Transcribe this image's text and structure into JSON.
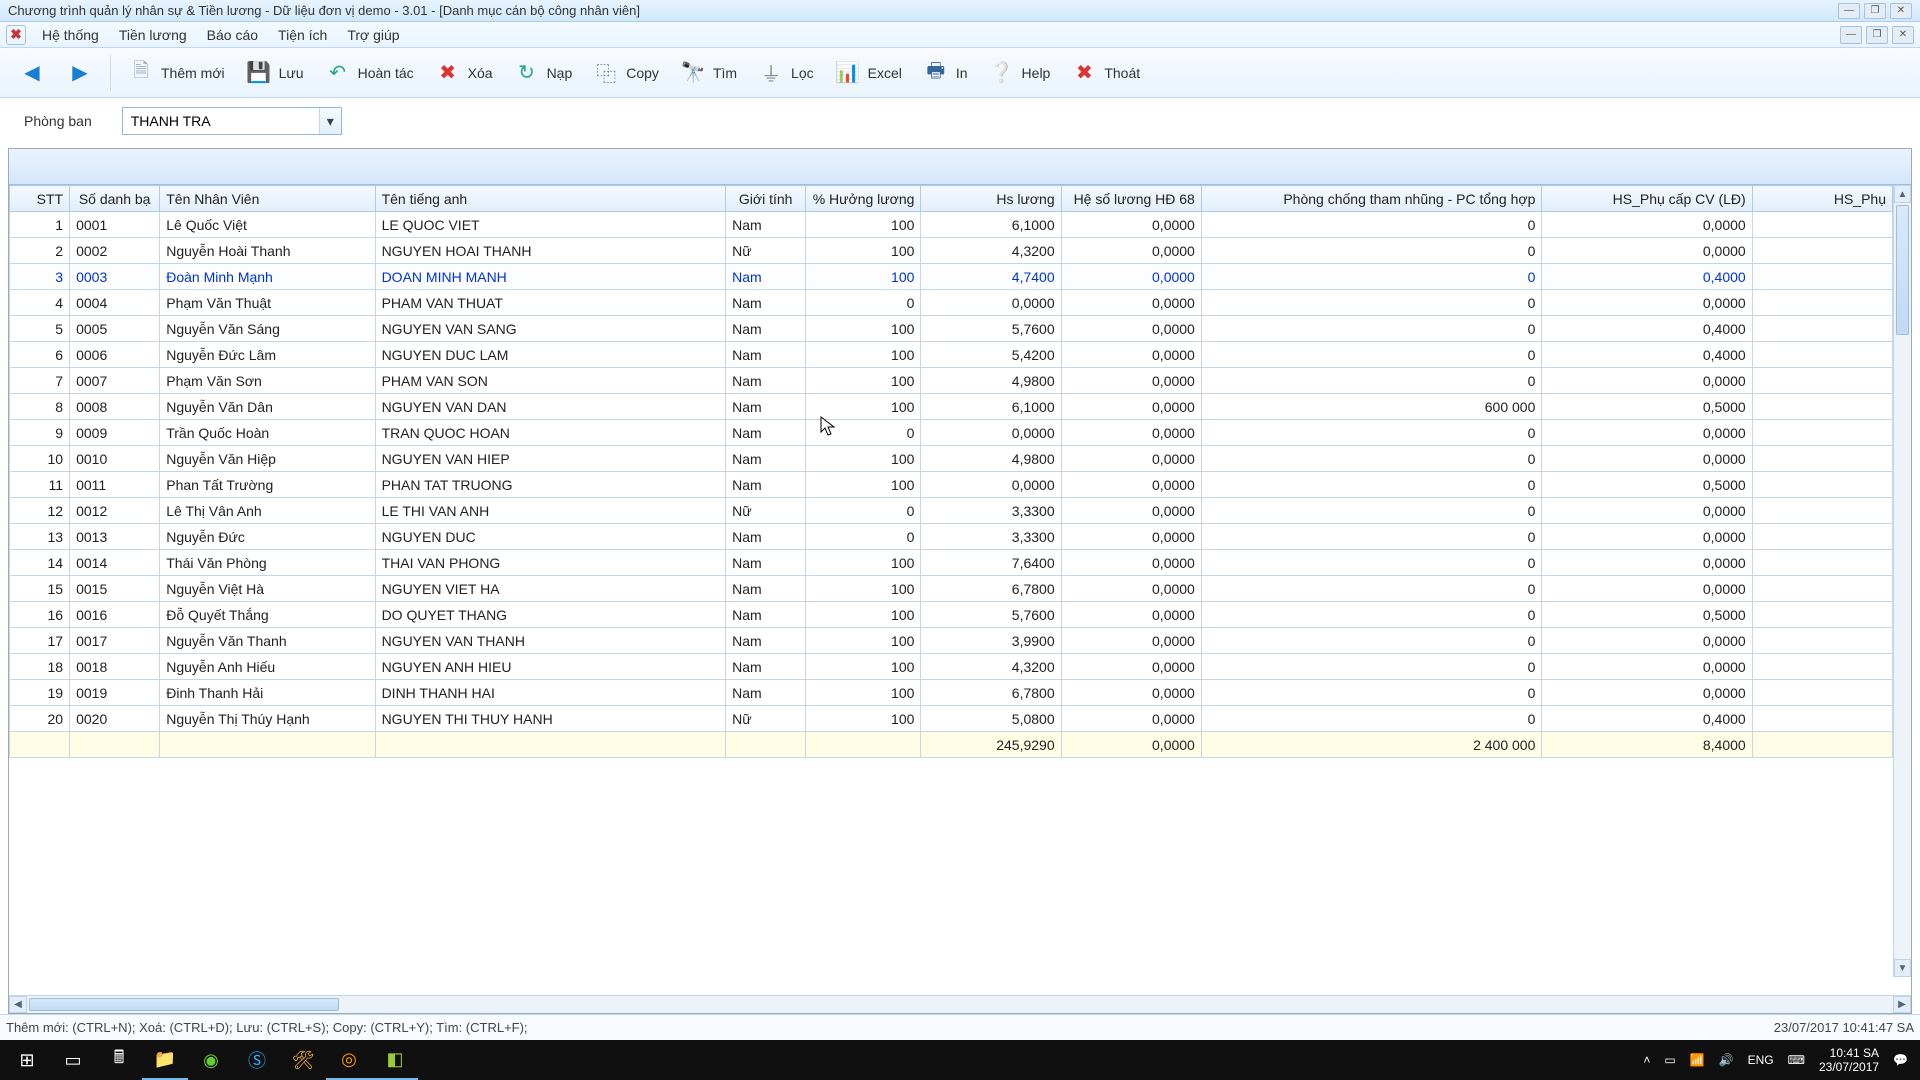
{
  "title": "Chương trình quản lý nhân sự & Tiền lương - Dữ liệu đơn vị demo - 3.01 - [Danh mục cán bộ công nhân viên]",
  "menu": {
    "ht": "Hệ thống",
    "tl": "Tiền lương",
    "bc": "Báo cáo",
    "ti": "Tiện ích",
    "tg": "Trợ giúp"
  },
  "toolbar": {
    "them": "Thêm mới",
    "luu": "Lưu",
    "undo": "Hoàn tác",
    "xoa": "Xóa",
    "nap": "Nạp",
    "copy": "Copy",
    "tim": "Tìm",
    "loc": "Lọc",
    "excel": "Excel",
    "in": "In",
    "help": "Help",
    "thoat": "Thoát"
  },
  "filter": {
    "label": "Phòng ban",
    "value": "THANH TRA"
  },
  "columns": {
    "stt": "STT",
    "sdb": "Số danh bạ",
    "tnv": "Tên Nhân Viên",
    "tta": "Tên tiếng anh",
    "gt": "Giới tính",
    "hl": "% Hưởng lương",
    "hsl": "Hs lương",
    "hs68": "Hệ số lương HĐ 68",
    "pctn": "Phòng chống tham nhũng - PC tổng hợp",
    "pccv": "HS_Phụ cấp CV (LĐ)",
    "hsphu": "HS_Phụ"
  },
  "rows": [
    {
      "stt": "1",
      "sdb": "0001",
      "tnv": "Lê Quốc Việt",
      "tta": "LE QUOC VIET",
      "gt": "Nam",
      "hl": "100",
      "hsl": "6,1000",
      "hs68": "0,0000",
      "pctn": "0",
      "pccv": "0,0000"
    },
    {
      "stt": "2",
      "sdb": "0002",
      "tnv": "Nguyễn Hoài Thanh",
      "tta": "NGUYEN HOAI THANH",
      "gt": "Nữ",
      "hl": "100",
      "hsl": "4,3200",
      "hs68": "0,0000",
      "pctn": "0",
      "pccv": "0,0000"
    },
    {
      "stt": "3",
      "sdb": "0003",
      "tnv": "Đoàn Minh Mạnh",
      "tta": "DOAN MINH MANH",
      "gt": "Nam",
      "hl": "100",
      "hsl": "4,7400",
      "hs68": "0,0000",
      "pctn": "0",
      "pccv": "0,4000"
    },
    {
      "stt": "4",
      "sdb": "0004",
      "tnv": "Phạm Văn Thuật",
      "tta": "PHAM VAN THUAT",
      "gt": "Nam",
      "hl": "0",
      "hsl": "0,0000",
      "hs68": "0,0000",
      "pctn": "0",
      "pccv": "0,0000"
    },
    {
      "stt": "5",
      "sdb": "0005",
      "tnv": "Nguyễn Văn Sáng",
      "tta": "NGUYEN VAN SANG",
      "gt": "Nam",
      "hl": "100",
      "hsl": "5,7600",
      "hs68": "0,0000",
      "pctn": "0",
      "pccv": "0,4000"
    },
    {
      "stt": "6",
      "sdb": "0006",
      "tnv": "Nguyễn Đức Lâm",
      "tta": "NGUYEN DUC LAM",
      "gt": "Nam",
      "hl": "100",
      "hsl": "5,4200",
      "hs68": "0,0000",
      "pctn": "0",
      "pccv": "0,4000"
    },
    {
      "stt": "7",
      "sdb": "0007",
      "tnv": "Phạm Văn Sơn",
      "tta": "PHAM VAN SON",
      "gt": "Nam",
      "hl": "100",
      "hsl": "4,9800",
      "hs68": "0,0000",
      "pctn": "0",
      "pccv": "0,0000"
    },
    {
      "stt": "8",
      "sdb": "0008",
      "tnv": "Nguyễn Văn Dân",
      "tta": "NGUYEN VAN DAN",
      "gt": "Nam",
      "hl": "100",
      "hsl": "6,1000",
      "hs68": "0,0000",
      "pctn": "600 000",
      "pccv": "0,5000"
    },
    {
      "stt": "9",
      "sdb": "0009",
      "tnv": "Trần Quốc Hoàn",
      "tta": "TRAN QUOC HOAN",
      "gt": "Nam",
      "hl": "0",
      "hsl": "0,0000",
      "hs68": "0,0000",
      "pctn": "0",
      "pccv": "0,0000"
    },
    {
      "stt": "10",
      "sdb": "0010",
      "tnv": "Nguyễn Văn Hiệp",
      "tta": "NGUYEN VAN HIEP",
      "gt": "Nam",
      "hl": "100",
      "hsl": "4,9800",
      "hs68": "0,0000",
      "pctn": "0",
      "pccv": "0,0000"
    },
    {
      "stt": "11",
      "sdb": "0011",
      "tnv": "Phan Tất Trường",
      "tta": "PHAN TAT TRUONG",
      "gt": "Nam",
      "hl": "100",
      "hsl": "0,0000",
      "hs68": "0,0000",
      "pctn": "0",
      "pccv": "0,5000"
    },
    {
      "stt": "12",
      "sdb": "0012",
      "tnv": "Lê Thị Vân Anh",
      "tta": "LE THI VAN ANH",
      "gt": "Nữ",
      "hl": "0",
      "hsl": "3,3300",
      "hs68": "0,0000",
      "pctn": "0",
      "pccv": "0,0000"
    },
    {
      "stt": "13",
      "sdb": "0013",
      "tnv": "Nguyễn Đức",
      "tta": "NGUYEN DUC",
      "gt": "Nam",
      "hl": "0",
      "hsl": "3,3300",
      "hs68": "0,0000",
      "pctn": "0",
      "pccv": "0,0000"
    },
    {
      "stt": "14",
      "sdb": "0014",
      "tnv": "Thái Văn Phòng",
      "tta": "THAI VAN PHONG",
      "gt": "Nam",
      "hl": "100",
      "hsl": "7,6400",
      "hs68": "0,0000",
      "pctn": "0",
      "pccv": "0,0000"
    },
    {
      "stt": "15",
      "sdb": "0015",
      "tnv": "Nguyễn Việt Hà",
      "tta": "NGUYEN VIET HA",
      "gt": "Nam",
      "hl": "100",
      "hsl": "6,7800",
      "hs68": "0,0000",
      "pctn": "0",
      "pccv": "0,0000"
    },
    {
      "stt": "16",
      "sdb": "0016",
      "tnv": "Đỗ Quyết Thắng",
      "tta": "DO QUYET THANG",
      "gt": "Nam",
      "hl": "100",
      "hsl": "5,7600",
      "hs68": "0,0000",
      "pctn": "0",
      "pccv": "0,5000"
    },
    {
      "stt": "17",
      "sdb": "0017",
      "tnv": "Nguyễn Văn Thanh",
      "tta": "NGUYEN VAN THANH",
      "gt": "Nam",
      "hl": "100",
      "hsl": "3,9900",
      "hs68": "0,0000",
      "pctn": "0",
      "pccv": "0,0000"
    },
    {
      "stt": "18",
      "sdb": "0018",
      "tnv": "Nguyễn Anh Hiếu",
      "tta": "NGUYEN ANH HIEU",
      "gt": "Nam",
      "hl": "100",
      "hsl": "4,3200",
      "hs68": "0,0000",
      "pctn": "0",
      "pccv": "0,0000"
    },
    {
      "stt": "19",
      "sdb": "0019",
      "tnv": "Đinh Thanh Hải",
      "tta": "DINH THANH HAI",
      "gt": "Nam",
      "hl": "100",
      "hsl": "6,7800",
      "hs68": "0,0000",
      "pctn": "0",
      "pccv": "0,0000"
    },
    {
      "stt": "20",
      "sdb": "0020",
      "tnv": "Nguyễn Thị Thúy Hạnh",
      "tta": "NGUYEN THI THUY HANH",
      "gt": "Nữ",
      "hl": "100",
      "hsl": "5,0800",
      "hs68": "0,0000",
      "pctn": "0",
      "pccv": "0,4000"
    }
  ],
  "selectedRow": 3,
  "totals": {
    "hsl": "245,9290",
    "hs68": "0,0000",
    "pctn": "2 400 000",
    "pccv": "8,4000"
  },
  "status": {
    "shortcuts": "Thêm mới: (CTRL+N);   Xoá: (CTRL+D);   Lưu: (CTRL+S);   Copy: (CTRL+Y);   Tìm: (CTRL+F);",
    "datetime": "23/07/2017 10:41:47 SA"
  },
  "tray": {
    "lang": "ENG",
    "time": "10:41 SA",
    "date": "23/07/2017"
  }
}
